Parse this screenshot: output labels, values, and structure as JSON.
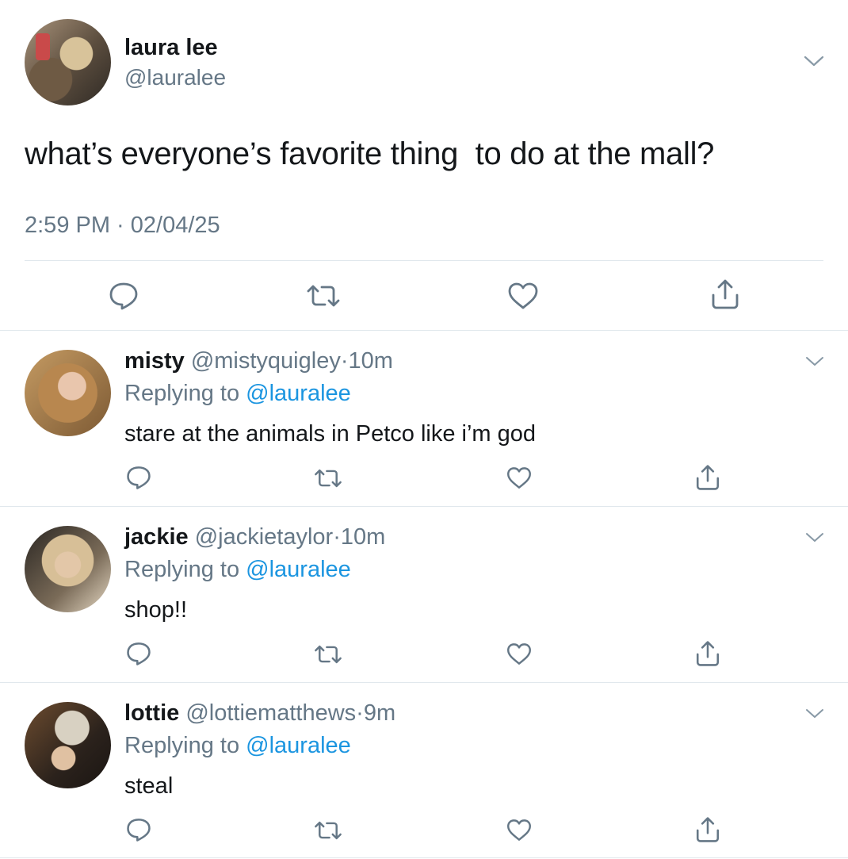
{
  "tweet": {
    "name": "laura lee",
    "handle": "@lauralee",
    "text": "what’s everyone’s favorite thing  to do at the mall?",
    "timestamp": "2:59 PM · 02/04/25"
  },
  "icons": {
    "reply": "comment-icon",
    "retweet": "retweet-icon",
    "like": "heart-icon",
    "share": "share-icon",
    "more": "chevron-down-icon"
  },
  "colors": {
    "text": "#14171a",
    "secondary": "#657786",
    "link": "#1b95e0",
    "divider": "#e1e8ed"
  },
  "replies": [
    {
      "name": "misty",
      "handle": "@mistyquigley",
      "dot": "·",
      "time": "10m",
      "replying_label": "Replying to",
      "mention": "@lauralee",
      "text": "stare at the animals in Petco like i’m god"
    },
    {
      "name": "jackie",
      "handle": "@jackietaylor",
      "dot": "·",
      "time": "10m",
      "replying_label": "Replying to",
      "mention": "@lauralee",
      "text": "shop!!"
    },
    {
      "name": "lottie",
      "handle": "@lottiematthews",
      "dot": "·",
      "time": "9m",
      "replying_label": "Replying to",
      "mention": "@lauralee",
      "text": "steal"
    }
  ]
}
